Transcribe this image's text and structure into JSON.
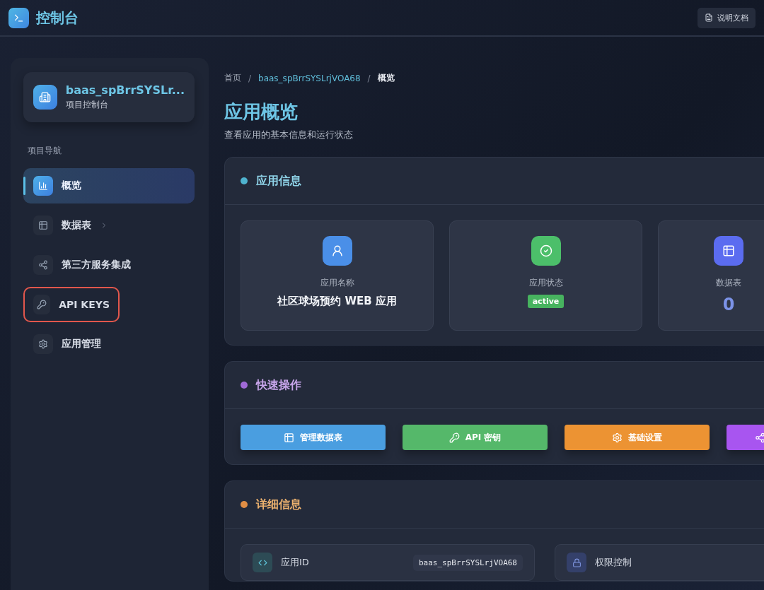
{
  "header": {
    "title": "控制台",
    "docs_button": "说明文档"
  },
  "sidebar": {
    "project_name": "baas_spBrrSYSLr...",
    "project_subtitle": "项目控制台",
    "section_label": "项目导航",
    "items": [
      {
        "label": "概览",
        "selected": true,
        "has_submenu": false,
        "highlighted": false
      },
      {
        "label": "数据表",
        "selected": false,
        "has_submenu": true,
        "highlighted": false
      },
      {
        "label": "第三方服务集成",
        "selected": false,
        "has_submenu": false,
        "highlighted": false
      },
      {
        "label": "API KEYS",
        "selected": false,
        "has_submenu": false,
        "highlighted": true
      },
      {
        "label": "应用管理",
        "selected": false,
        "has_submenu": false,
        "highlighted": false
      }
    ]
  },
  "breadcrumb": {
    "separator": "/",
    "items": [
      {
        "label": "首页",
        "kind": "plain"
      },
      {
        "label": "baas_spBrrSYSLrjVOA68",
        "kind": "link"
      },
      {
        "label": "概览",
        "kind": "current"
      }
    ]
  },
  "page": {
    "title": "应用概览",
    "subtitle": "查看应用的基本信息和运行状态"
  },
  "info_panel": {
    "title": "应用信息",
    "color": "#4fb3cf",
    "cards": [
      {
        "kind": "text",
        "color": "#4a8fe8",
        "label": "应用名称",
        "value": "社区球场预约 WEB 应用"
      },
      {
        "kind": "badge",
        "color": "#4cbf6a",
        "label": "应用状态",
        "value": "active"
      },
      {
        "kind": "number",
        "color": "#5b6cf0",
        "label": "数据表",
        "value": "0"
      }
    ]
  },
  "actions_panel": {
    "title": "快速操作",
    "color": "#a06ad8",
    "buttons": [
      {
        "label": "管理数据表",
        "color": "#4a9ee0"
      },
      {
        "label": "API 密钥",
        "color": "#55b86a"
      },
      {
        "label": "基础设置",
        "color": "#ec9333"
      },
      {
        "color": "#a855f0"
      }
    ]
  },
  "details_panel": {
    "title": "详细信息",
    "color": "#e08e45",
    "rows": [
      {
        "label": "应用ID",
        "value": "baas_spBrrSYSLrjVOA68"
      },
      {
        "label": "权限控制"
      }
    ]
  }
}
